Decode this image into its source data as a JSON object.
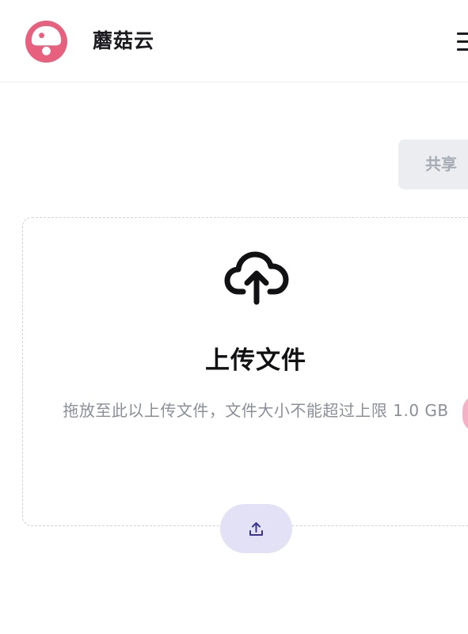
{
  "header": {
    "app_name": "蘑菇云",
    "logo_icon": "mushroom-logo",
    "menu_icon": "hamburger-menu-icon"
  },
  "actions": {
    "share_label": "共享"
  },
  "upload": {
    "icon": "cloud-upload-icon",
    "title": "上传文件",
    "description": "拖放至此以上传文件，文件大小不能超过上限 1.0 GB",
    "button_icon": "upload-icon"
  },
  "colors": {
    "brand_pink": "#e7617f",
    "upload_button_bg": "#e3e1f5",
    "upload_icon": "#3a3590",
    "share_button_bg": "#ebedf1",
    "share_button_text": "#a6abb4"
  }
}
